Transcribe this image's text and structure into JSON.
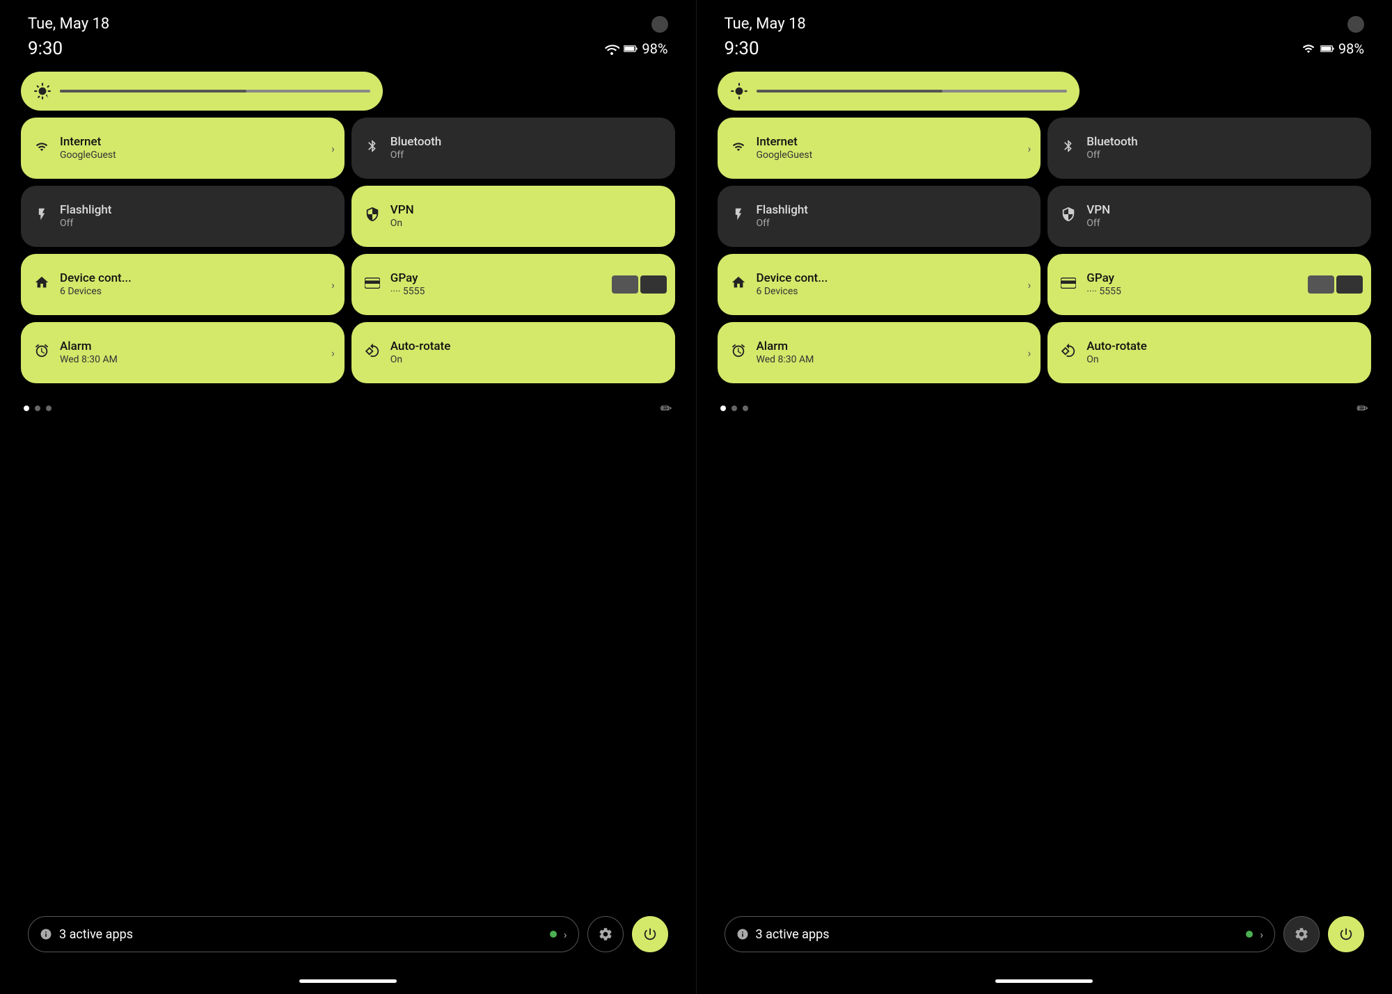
{
  "colors": {
    "bg": "#000000",
    "tile_active": "#d4e86a",
    "tile_inactive": "#2a2a2a",
    "text_dark": "#111111",
    "text_light": "#dddddd",
    "text_sub_dark": "#333333",
    "text_sub_light": "#aaaaaa",
    "green_dot": "#4caf50",
    "accent_btn": "#d4e86a"
  },
  "left_panel": {
    "date": "Tue, May 18",
    "time": "9:30",
    "battery": "98%",
    "brightness_slider": 60,
    "tiles": [
      {
        "id": "internet",
        "label": "Internet",
        "sublabel": "GoogleGuest",
        "active": true,
        "has_arrow": true,
        "icon": "wifi"
      },
      {
        "id": "bluetooth",
        "label": "Bluetooth",
        "sublabel": "Off",
        "active": false,
        "has_arrow": false,
        "icon": "bluetooth"
      },
      {
        "id": "flashlight",
        "label": "Flashlight",
        "sublabel": "Off",
        "active": false,
        "has_arrow": false,
        "icon": "flashlight"
      },
      {
        "id": "vpn",
        "label": "VPN",
        "sublabel": "On",
        "active": true,
        "has_arrow": false,
        "icon": "vpn"
      },
      {
        "id": "device",
        "label": "Device cont...",
        "sublabel": "6 Devices",
        "active": true,
        "has_arrow": true,
        "icon": "device"
      },
      {
        "id": "gpay",
        "label": "GPay",
        "sublabel": "···· 5555",
        "active": true,
        "has_arrow": false,
        "has_cards": true,
        "icon": "gpay"
      },
      {
        "id": "alarm",
        "label": "Alarm",
        "sublabel": "Wed 8:30 AM",
        "active": true,
        "has_arrow": true,
        "icon": "alarm"
      },
      {
        "id": "autorotate",
        "label": "Auto-rotate",
        "sublabel": "On",
        "active": true,
        "has_arrow": false,
        "icon": "rotate"
      }
    ],
    "dots": [
      true,
      false,
      false
    ],
    "active_apps_count": "3",
    "active_apps_label": "active apps",
    "settings_label": "Settings",
    "power_label": "Power"
  },
  "right_panel": {
    "date": "Tue, May 18",
    "time": "9:30",
    "battery": "98%",
    "brightness_slider": 60,
    "tiles": [
      {
        "id": "internet",
        "label": "Internet",
        "sublabel": "GoogleGuest",
        "active": true,
        "has_arrow": true,
        "icon": "wifi"
      },
      {
        "id": "bluetooth",
        "label": "Bluetooth",
        "sublabel": "Off",
        "active": false,
        "has_arrow": false,
        "icon": "bluetooth"
      },
      {
        "id": "flashlight",
        "label": "Flashlight",
        "sublabel": "Off",
        "active": false,
        "has_arrow": false,
        "icon": "flashlight"
      },
      {
        "id": "vpn",
        "label": "VPN",
        "sublabel": "Off",
        "active": false,
        "has_arrow": false,
        "icon": "vpn"
      },
      {
        "id": "device",
        "label": "Device cont...",
        "sublabel": "6 Devices",
        "active": true,
        "has_arrow": true,
        "icon": "device"
      },
      {
        "id": "gpay",
        "label": "GPay",
        "sublabel": "···· 5555",
        "active": true,
        "has_arrow": false,
        "has_cards": true,
        "icon": "gpay"
      },
      {
        "id": "alarm",
        "label": "Alarm",
        "sublabel": "Wed 8:30 AM",
        "active": true,
        "has_arrow": true,
        "icon": "alarm"
      },
      {
        "id": "autorotate",
        "label": "Auto-rotate",
        "sublabel": "On",
        "active": true,
        "has_arrow": false,
        "icon": "rotate"
      }
    ],
    "dots": [
      true,
      false,
      false
    ],
    "active_apps_count": "3",
    "active_apps_label": "active apps",
    "settings_label": "Settings",
    "power_label": "Power"
  }
}
